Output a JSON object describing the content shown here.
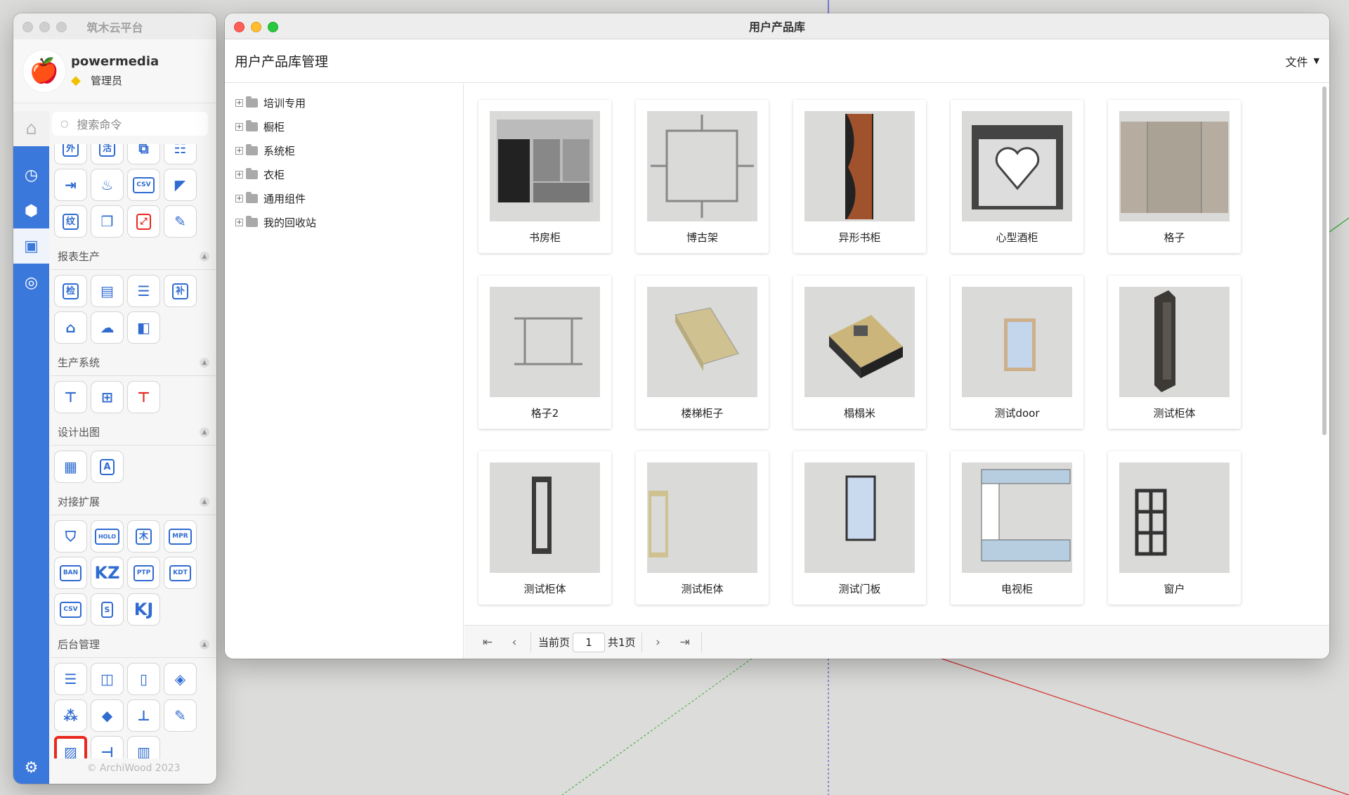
{
  "sidebar_window": {
    "title": "筑木云平台",
    "user": {
      "name": "powermedia",
      "role": "管理员"
    },
    "search_placeholder": "搜索命令",
    "top_tiles": [
      "外",
      "活",
      "cube-doc",
      "table",
      "export",
      "fire",
      "CSV",
      "corner",
      "纹",
      "box3d",
      "resize",
      "ruler"
    ],
    "sections": [
      {
        "title": "报表生产",
        "tiles": [
          "检",
          "report",
          "list",
          "补",
          "factory",
          "cloud-upload",
          "split"
        ]
      },
      {
        "title": "生产系统",
        "tiles": [
          "T",
          "hardware",
          "delete-hw"
        ]
      },
      {
        "title": "设计出图",
        "tiles": [
          "drawing",
          "A"
        ]
      },
      {
        "title": "对接扩展",
        "tiles": [
          "shield",
          "HOLO",
          "木",
          "MPR",
          "BAN",
          "KZ",
          "PTP",
          "KDT",
          "CSV",
          "S",
          "KJ"
        ]
      },
      {
        "title": "后台管理",
        "tiles": [
          "layers-box",
          "cabinet",
          "door",
          "stack",
          "cubes",
          "eraser",
          "bolt",
          "edit",
          "image",
          "bracket",
          "columns"
        ]
      }
    ],
    "footer": "© ArchiWood 2023"
  },
  "main_window": {
    "title": "用户产品库",
    "header_title": "用户产品库管理",
    "file_menu": "文件",
    "tree": [
      "培训专用",
      "橱柜",
      "系统柜",
      "衣柜",
      "通用组件",
      "我的回收站"
    ],
    "products": [
      "书房柜",
      "博古架",
      "异形书柜",
      "心型酒柜",
      "格子",
      "格子2",
      "楼梯柜子",
      "榻榻米",
      "测试door",
      "测试柜体",
      "测试柜体",
      "测试柜体",
      "测试门板",
      "电视柜",
      "窗户"
    ],
    "pager": {
      "current_label": "当前页",
      "current_page": "1",
      "total": "共1页"
    }
  },
  "colors": {
    "accent": "#3b78db",
    "selected_border": "#e8281e"
  }
}
